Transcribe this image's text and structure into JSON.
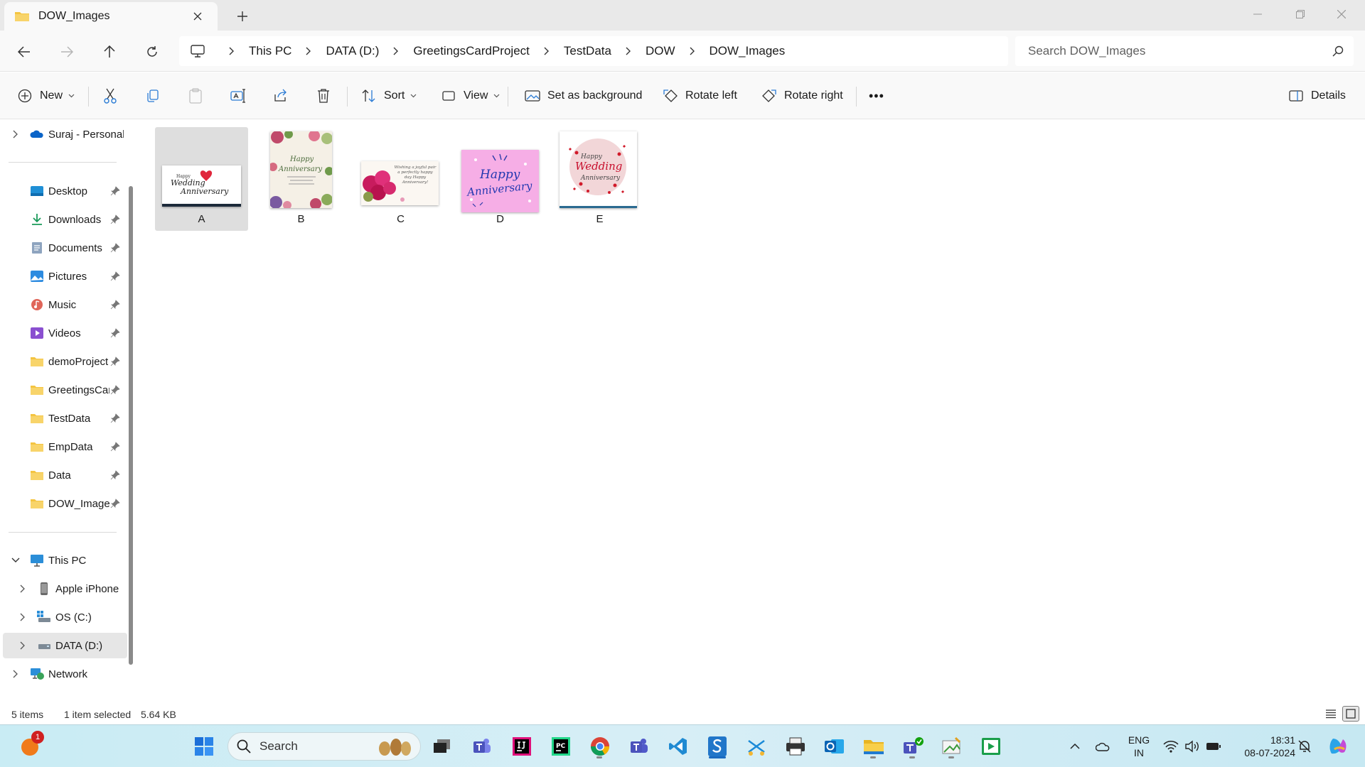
{
  "window": {
    "tab_title": "DOW_Images",
    "new_tab": "+",
    "controls": [
      "minimize",
      "restore",
      "close"
    ]
  },
  "address": {
    "breadcrumbs": [
      "This PC",
      "DATA (D:)",
      "GreetingsCardProject",
      "TestData",
      "DOW",
      "DOW_Images"
    ],
    "search_placeholder": "Search DOW_Images"
  },
  "commands": {
    "new": "New",
    "sort": "Sort",
    "view": "View",
    "set_background": "Set as background",
    "rotate_left": "Rotate left",
    "rotate_right": "Rotate right",
    "more": "•••",
    "details": "Details"
  },
  "sidebar": {
    "onedrive": "Suraj - Personal",
    "quick_access": [
      {
        "label": "Desktop",
        "icon": "desktop-icon"
      },
      {
        "label": "Downloads",
        "icon": "download-icon"
      },
      {
        "label": "Documents",
        "icon": "document-icon"
      },
      {
        "label": "Pictures",
        "icon": "pictures-icon"
      },
      {
        "label": "Music",
        "icon": "music-icon"
      },
      {
        "label": "Videos",
        "icon": "videos-icon"
      },
      {
        "label": "demoProject",
        "icon": "folder-icon"
      },
      {
        "label": "GreetingsCar",
        "icon": "folder-icon"
      },
      {
        "label": "TestData",
        "icon": "folder-icon"
      },
      {
        "label": "EmpData",
        "icon": "folder-icon"
      },
      {
        "label": "Data",
        "icon": "folder-icon"
      },
      {
        "label": "DOW_Images",
        "icon": "folder-icon"
      }
    ],
    "this_pc": "This PC",
    "drives": [
      {
        "label": "Apple iPhone",
        "icon": "phone-icon"
      },
      {
        "label": "OS (C:)",
        "icon": "drive-icon"
      },
      {
        "label": "DATA (D:)",
        "icon": "drive-icon"
      }
    ],
    "network": "Network"
  },
  "files": [
    {
      "name": "A",
      "selected": true
    },
    {
      "name": "B",
      "selected": false
    },
    {
      "name": "C",
      "selected": false
    },
    {
      "name": "D",
      "selected": false
    },
    {
      "name": "E",
      "selected": false
    }
  ],
  "thumbnails": {
    "a_line1": "Happy",
    "a_line2": "Wedding",
    "a_line3": "Anniversary",
    "b_line1": "Happy",
    "b_line2": "Anniversary",
    "c_text": "Wishing a joyful pair a perfectly happy day Happy Anniversary!",
    "d_line1": "Happy",
    "d_line2": "Anniversary",
    "e_line1": "Happy",
    "e_line2": "Wedding",
    "e_line3": "Anniversary"
  },
  "status": {
    "items": "5 items",
    "selection": "1 item selected",
    "size": "5.64 KB"
  },
  "taskbar": {
    "search": "Search",
    "notification_badge": "1",
    "lang_1": "ENG",
    "lang_2": "IN",
    "time": "18:31",
    "date": "08-07-2024",
    "icons": [
      "start-icon",
      "task-view-icon",
      "teams-icon",
      "intellij-icon",
      "pycharm-icon",
      "chrome-icon",
      "teams-work-icon",
      "vscode-icon",
      "app-s-icon",
      "snipping-icon",
      "printer-icon",
      "outlook-icon",
      "file-explorer-icon",
      "teams-new-icon",
      "paint-icon",
      "media-player-icon"
    ]
  },
  "colors": {
    "accent": "#0067c0",
    "folder": "#f4c441",
    "taskbar": "#cdedf4"
  }
}
